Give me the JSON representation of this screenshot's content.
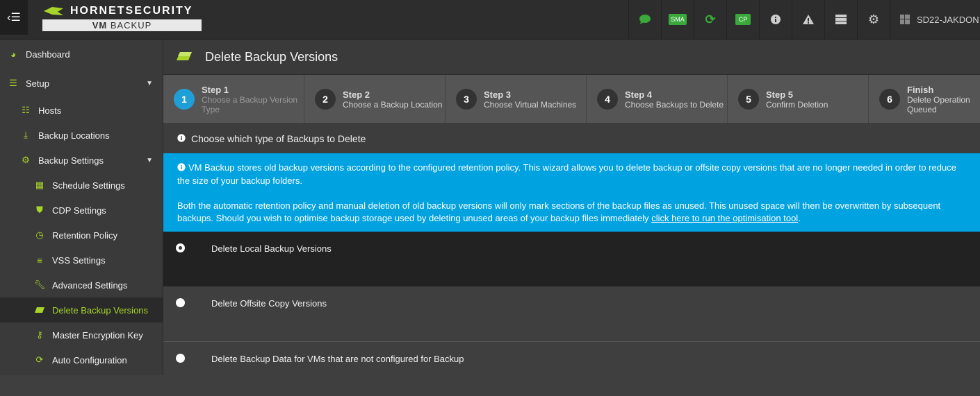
{
  "topbar": {
    "logo_line1": "HORNETSECURITY",
    "logo_line2_a": "VM",
    "logo_line2_b": "BACKUP",
    "icons": [
      "chat-icon",
      "sma-badge",
      "refresh-icon",
      "cp-badge",
      "info-icon",
      "warning-icon",
      "server-list-icon",
      "gears-icon",
      "windows-icon"
    ],
    "sma_label": "SMA",
    "cp_label": "CP",
    "server_name": "SD22-JAKDON",
    "accent": "#a8d42a"
  },
  "sidebar": {
    "dashboard": "Dashboard",
    "setup": "Setup",
    "hosts": "Hosts",
    "backup_locations": "Backup Locations",
    "backup_settings": "Backup Settings",
    "schedule_settings": "Schedule Settings",
    "cdp_settings": "CDP Settings",
    "retention_policy": "Retention Policy",
    "vss_settings": "VSS Settings",
    "advanced_settings": "Advanced Settings",
    "delete_backup_versions": "Delete Backup Versions",
    "master_encryption_key": "Master Encryption Key",
    "auto_configuration": "Auto Configuration"
  },
  "page": {
    "title": "Delete Backup Versions"
  },
  "steps": [
    {
      "num": "1",
      "title": "Step 1",
      "desc": "Choose a Backup Version Type"
    },
    {
      "num": "2",
      "title": "Step 2",
      "desc": "Choose a Backup Location"
    },
    {
      "num": "3",
      "title": "Step 3",
      "desc": "Choose Virtual Machines"
    },
    {
      "num": "4",
      "title": "Step 4",
      "desc": "Choose Backups to Delete"
    },
    {
      "num": "5",
      "title": "Step 5",
      "desc": "Confirm Deletion"
    },
    {
      "num": "6",
      "title": "Finish",
      "desc": "Delete Operation Queued"
    }
  ],
  "section": {
    "title": "Choose which type of Backups to Delete"
  },
  "info": {
    "para1": "VM Backup stores old backup versions according to the configured retention policy. This wizard allows you to delete backup or offsite copy versions that are no longer needed in order to reduce the size of your backup folders.",
    "para2": "Both the automatic retention policy and manual deletion of old backup versions will only mark sections of the backup files as unused. This unused space will then be overwritten by subsequent backups. Should you wish to optimise backup storage used by deleting unused areas of your backup files immediately",
    "link": "click here to run the optimisation tool",
    "para2_end": ".",
    "color": "#00a2e0"
  },
  "options": [
    {
      "label": "Delete Local Backup Versions",
      "selected": true
    },
    {
      "label": "Delete Offsite Copy Versions",
      "selected": false
    },
    {
      "label": "Delete Backup Data for VMs that are not configured for Backup",
      "selected": false
    }
  ]
}
